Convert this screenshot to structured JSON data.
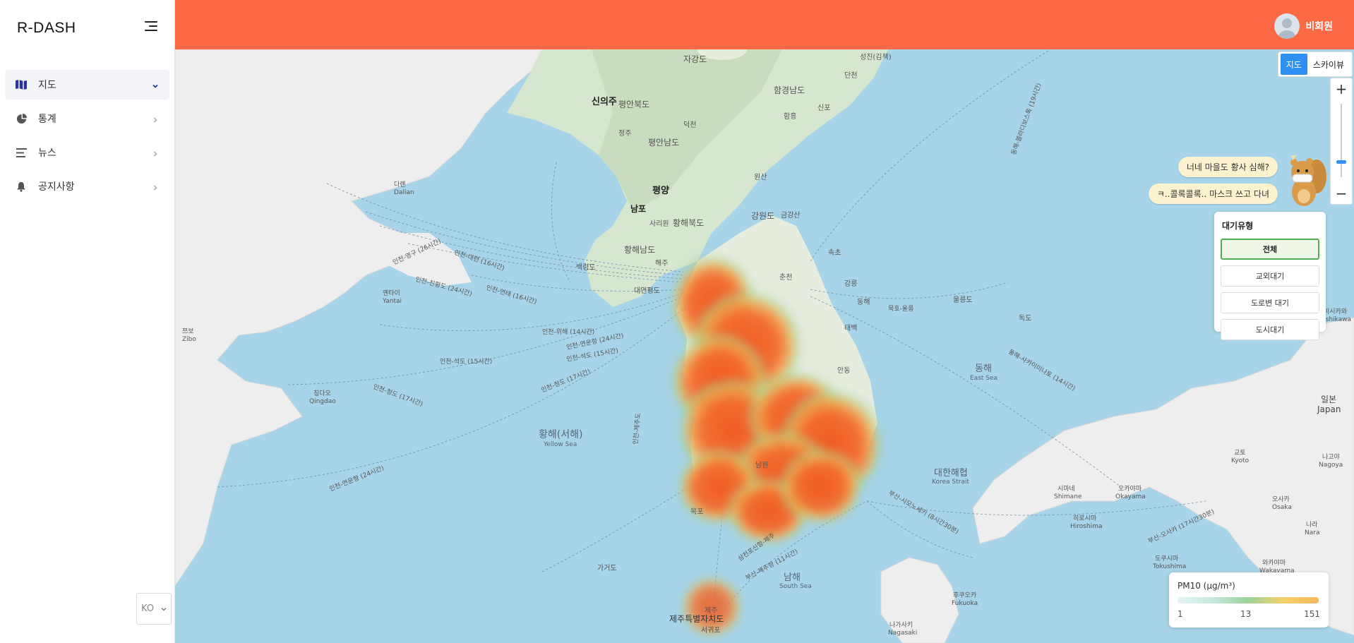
{
  "app": {
    "brand": "R-DASH"
  },
  "sidebar": {
    "items": [
      {
        "label": "지도",
        "icon": "map-icon",
        "active": true,
        "expanded": true
      },
      {
        "label": "통계",
        "icon": "pie-chart-icon",
        "active": false
      },
      {
        "label": "뉴스",
        "icon": "list-icon",
        "active": false
      },
      {
        "label": "공지사항",
        "icon": "bell-icon",
        "active": false
      }
    ],
    "language": "KO"
  },
  "header": {
    "user_name": "비회원"
  },
  "map": {
    "view_toggle": {
      "map_label": "지도",
      "skyview_label": "스카이뷰",
      "selected": "지도"
    },
    "zoom": {
      "in_label": "+",
      "out_label": "−",
      "level": 0.2
    },
    "bubbles": {
      "line1": "너네 마을도 황사 심해?",
      "line2": "ㅋ..콜록콜록.. 마스크 쓰고 다녀"
    },
    "air_type": {
      "title": "대기유형",
      "options": [
        "전체",
        "교외대기",
        "도로변 대기",
        "도시대기"
      ],
      "selected": "전체"
    },
    "legend": {
      "title": "PM10 (μg/m³)",
      "min": "1",
      "mid": "13",
      "max": "151"
    },
    "labels": {
      "jagang": "자강도",
      "seongjin": "성진(김책)",
      "dancheon": "단천",
      "hamgyeongnam": "함경남도",
      "hamheung": "함흥",
      "sinpo": "신포",
      "sinuiju": "신의주",
      "pyeonganbuk": "평안북도",
      "jeongju": "정주",
      "deokcheon": "덕천",
      "pyongannam": "평안남도",
      "wonsan": "원산",
      "pyongyang": "평양",
      "nampo": "남포",
      "sariwon": "사리원",
      "hwanghaebuk": "황해북도",
      "gangwon_n": "강원도",
      "geumgangsan": "금강산",
      "hwanghaenam": "황해남도",
      "haeju": "해주",
      "baengnyeong": "백령도",
      "yeonpyeong": "대연평도",
      "sokcho": "속초",
      "chuncheon": "춘천",
      "gangneung": "강릉",
      "donghae": "동해",
      "taebaek": "태백",
      "andong": "안동",
      "ulleungdo": "울릉도",
      "dokdo": "독도",
      "ulleung_route": "묵호-울릉",
      "dalian_ko": "다롄",
      "dalian_en": "Dalian",
      "yantai_ko": "옌타이",
      "yantai_en": "Yantai",
      "zibo_ko": "쯔보",
      "zibo_en": "Zibo",
      "qingdao_ko": "칭다오",
      "qingdao_en": "Qingdao",
      "yellow_sea_ko": "황해(서해)",
      "yellow_sea_en": "Yellow Sea",
      "east_sea_ko": "동해",
      "east_sea_en": "East Sea",
      "korea_strait_ko": "대한해협",
      "korea_strait_en": "Korea Strait",
      "south_sea_ko": "남해",
      "south_sea_en": "South Sea",
      "japan_ko": "일본",
      "japan_en": "Japan",
      "kyoto_ko": "교토",
      "kyoto_en": "Kyoto",
      "nagoya_ko": "나고야",
      "nagoya_en": "Nagoya",
      "osaka_ko": "오사카",
      "osaka_en": "Osaka",
      "shimane_ko": "시마네",
      "shimane_en": "Shimane",
      "okayama_ko": "오카야마",
      "okayama_en": "Okayama",
      "hiroshima_ko": "히로시마",
      "hiroshima_en": "Hiroshima",
      "nara_ko": "나라",
      "nara_en": "Nara",
      "tokushima_ko": "도쿠시마",
      "tokushima_en": "Tokushima",
      "wakayama_ko": "와카야마",
      "wakayama_en": "Wakayama",
      "fukuoka_ko": "후쿠오카",
      "fukuoka_en": "Fukuoka",
      "nagasaki_ko": "나가사키",
      "nagasaki_en": "Nagasaki",
      "ishikawa_ko": "이시카와",
      "ishikawa_en": "Ishikawa",
      "gageodo": "가거도",
      "jeju_special": "제주특별자치도",
      "jeju": "제주",
      "seogwipo": "서귀포",
      "mokpo": "목포",
      "namwon": "남원",
      "busan_jeju_route": "부산-제주항 (11시간)",
      "samcheonpo_jeju_route": "삼천포신항-제주",
      "incheon_jeju_route": "인천-제주도",
      "incheon_yeongu": "인천-영구 (26시간)",
      "incheon_jinhwangdao": "인천-친황도 (24시간)",
      "incheon_dalian": "인천-대련 (16시간)",
      "incheon_yantai": "인천-연태 (16시간)",
      "incheon_weihai": "인천-위해 (14시간)",
      "incheon_lianyungang": "인천-연운항 (24시간)",
      "incheon_shidao": "인천-석도 (15시간)",
      "incheon_shidao2": "인천-석도 (15시간)",
      "incheon_qingdao": "인천-청도 (17시간)",
      "incheon_qingdao2": "인천-청도 (17시간)",
      "incheon_lianyungang2": "인천-연운항 (24시간)",
      "donghae_sakaiminato": "동해-사카이미나토 (14시간)",
      "busan_osaka": "부산-오사카 (17시간30분)",
      "busan_shimonoseki": "부산-시모노세키 (8시간30분)",
      "ulleung_vertical": "동해-블라디보스톡 (19시간)"
    }
  }
}
